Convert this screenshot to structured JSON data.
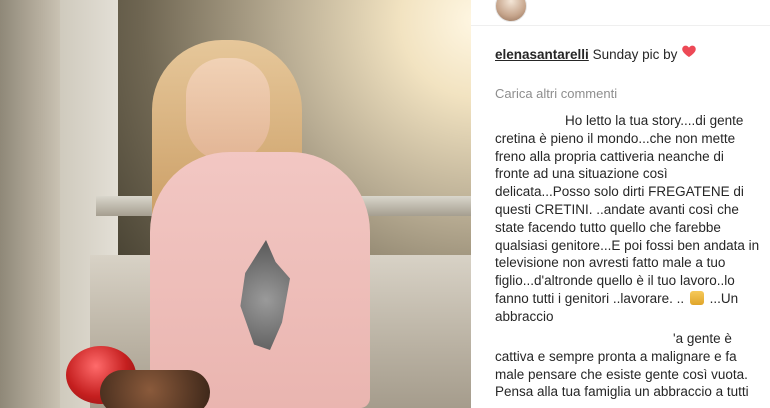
{
  "post": {
    "caption_username": "elenasantarelli",
    "caption_text": "Sunday pic by"
  },
  "comments": {
    "load_more_label": "Carica altri commenti",
    "c1": {
      "username": "",
      "lines": [
        "Ho letto la tua story....di gente",
        "cretina è pieno il mondo...che non mette",
        "freno alla propria cattiveria neanche di",
        "fronte ad una situazione così",
        "delicata...Posso solo dirti FREGATENE di",
        "questi CRETINI. ..andate avanti così che",
        "state facendo tutto quello che farebbe",
        "qualsiasi genitore...E poi fossi ben andata in",
        "televisione non avresti fatto male a tuo",
        "figlio...d'altronde quello è il tuo lavoro..lo",
        "fanno tutti i genitori ..lavorare. ..",
        "abbraccio"
      ],
      "tail_text": "...Un",
      "emoji": "flexed-biceps-emoji"
    },
    "c2": {
      "username": "",
      "lines": [
        "'a gente è",
        "cattiva e sempre pronta a malignare e fa",
        "male pensare che esiste gente così vuota.",
        "Pensa alla tua famiglia un abbraccio a tutti"
      ]
    }
  },
  "icons": {
    "heart": "heart-icon"
  },
  "colors": {
    "text": "#262626",
    "muted": "#8e8e8e",
    "heart": "#ed4956",
    "divider": "#efefef"
  }
}
